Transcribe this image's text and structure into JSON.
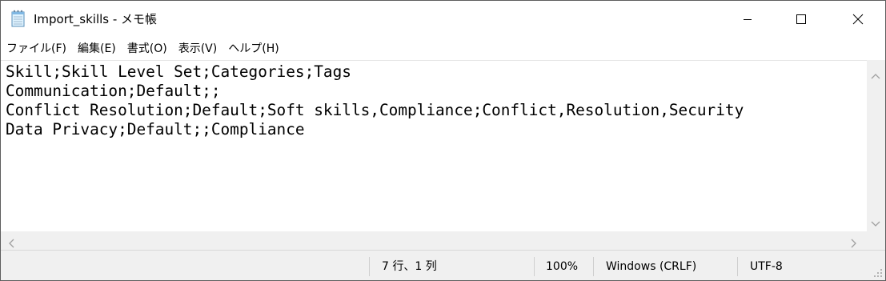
{
  "window": {
    "title": "Import_skills - メモ帳"
  },
  "menu": {
    "items": [
      "ファイル(F)",
      "編集(E)",
      "書式(O)",
      "表示(V)",
      "ヘルプ(H)"
    ]
  },
  "editor": {
    "lines": [
      "Skill;Skill Level Set;Categories;Tags",
      "Communication;Default;;",
      "Conflict Resolution;Default;Soft skills,Compliance;Conflict,Resolution,Security",
      "Data Privacy;Default;;Compliance",
      "",
      "",
      ""
    ]
  },
  "status": {
    "position": "7 行、1 列",
    "zoom": "100%",
    "line_ending": "Windows (CRLF)",
    "encoding": "UTF-8"
  },
  "icons": {
    "app": "notepad-icon",
    "minimize": "minimize-icon",
    "maximize": "maximize-icon",
    "close": "close-icon"
  }
}
